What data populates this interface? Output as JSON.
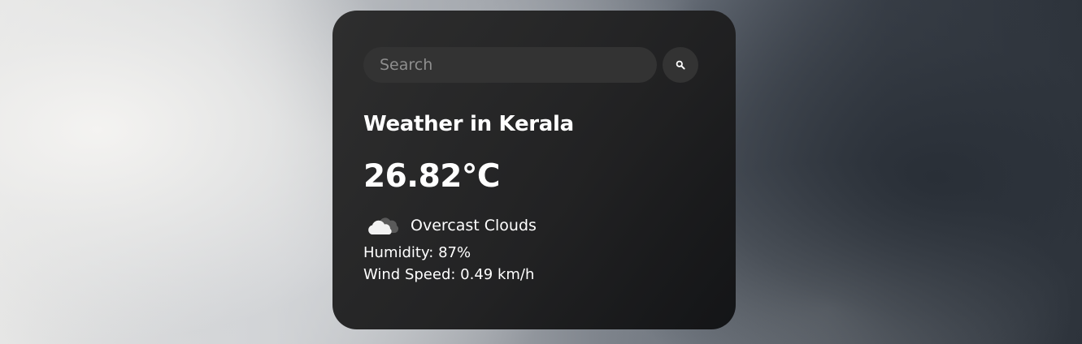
{
  "search": {
    "placeholder": "Search",
    "button_icon": "search-icon"
  },
  "weather": {
    "city_title": "Weather in Kerala",
    "temperature": "26.82°C",
    "icon": "overcast-clouds-icon",
    "description": "Overcast Clouds",
    "humidity": "Humidity: 87%",
    "wind_speed": "Wind Speed: 0.49 km/h"
  },
  "colors": {
    "card_background": "#232323",
    "input_background": "#333333",
    "text": "#ffffff",
    "placeholder": "#8e8e8e"
  }
}
